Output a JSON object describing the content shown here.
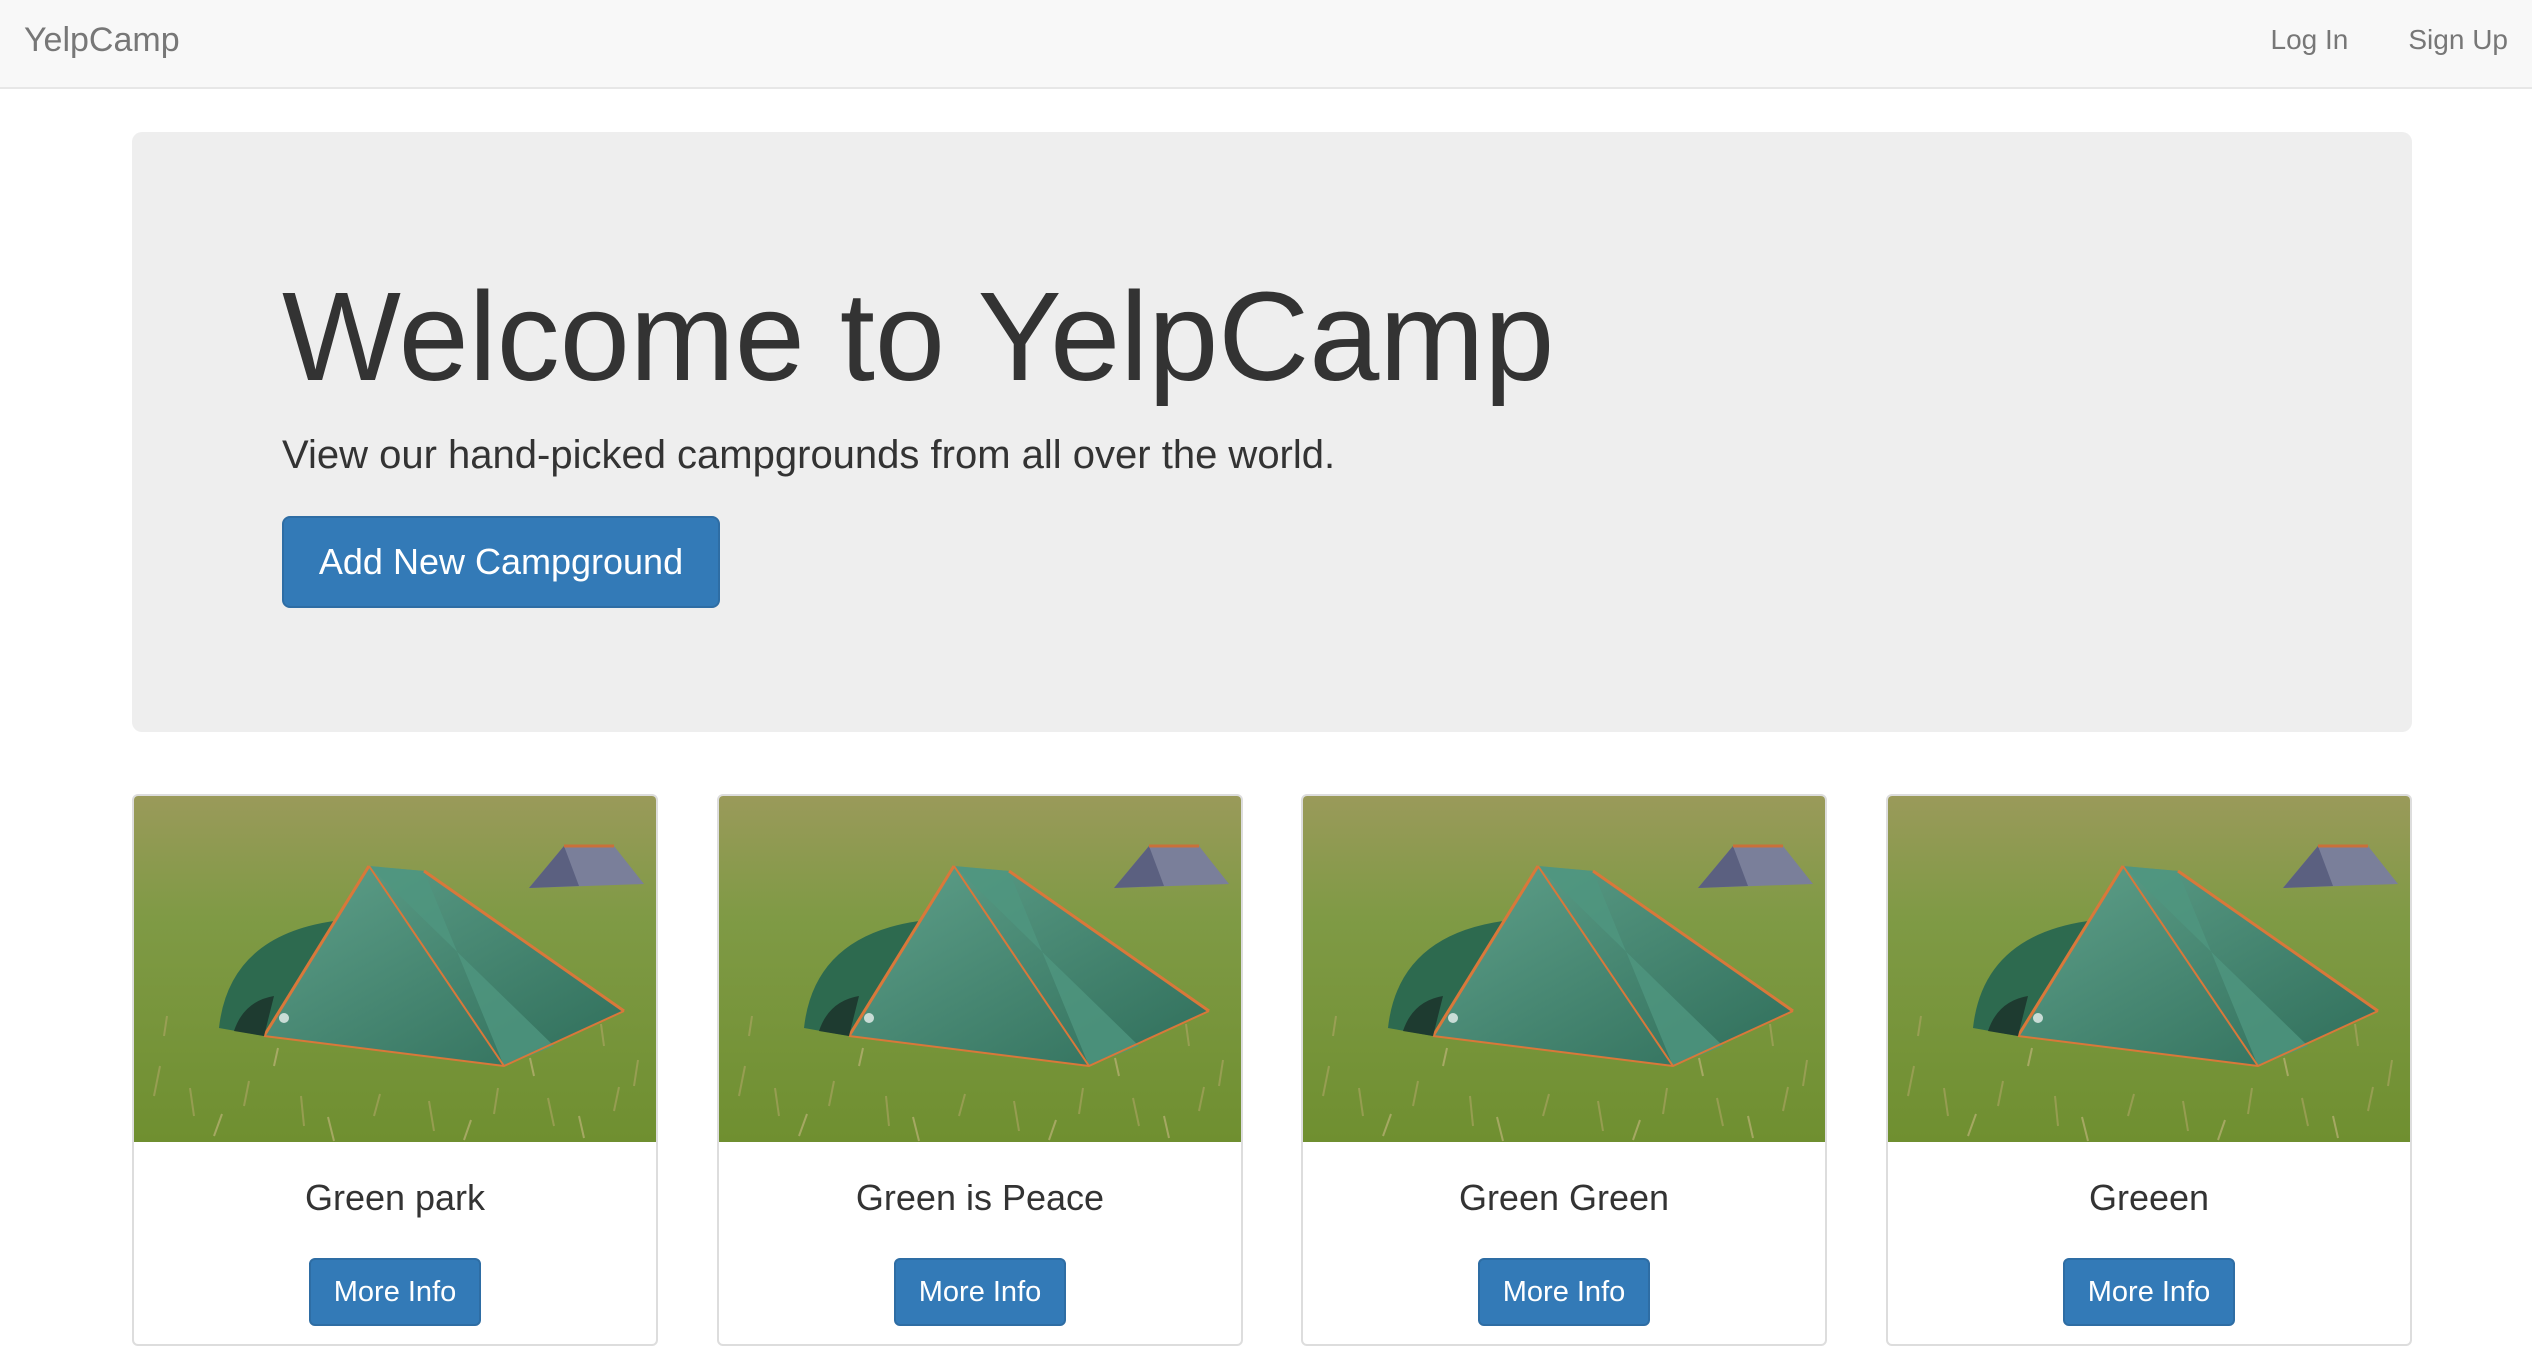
{
  "navbar": {
    "brand": "YelpCamp",
    "login_label": "Log In",
    "signup_label": "Sign Up"
  },
  "jumbotron": {
    "title": "Welcome to YelpCamp",
    "subtitle": "View our hand-picked campgrounds from all over the world.",
    "button_label": "Add New Campground"
  },
  "campgrounds": [
    {
      "name": "Green park",
      "button_label": "More Info"
    },
    {
      "name": "Green is Peace",
      "button_label": "More Info"
    },
    {
      "name": "Green Green",
      "button_label": "More Info"
    },
    {
      "name": "Greeen",
      "button_label": "More Info"
    }
  ],
  "colors": {
    "primary": "#337ab7",
    "navbar_bg": "#f8f8f8",
    "jumbotron_bg": "#eeeeee"
  }
}
